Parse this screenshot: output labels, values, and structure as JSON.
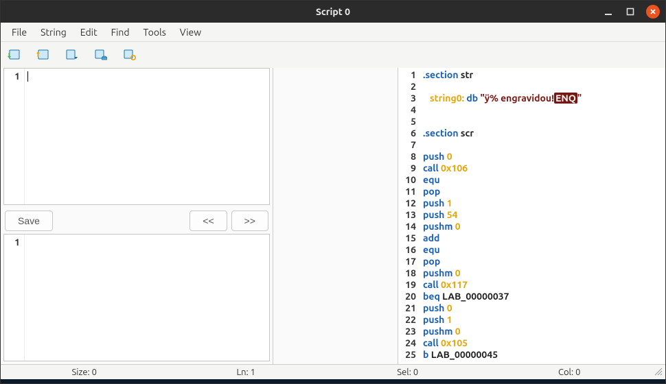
{
  "window": {
    "title": "Script 0"
  },
  "menu": {
    "file": "File",
    "string": "String",
    "edit": "Edit",
    "find": "Find",
    "tools": "Tools",
    "view": "View"
  },
  "left_editor": {
    "line1_no": "1"
  },
  "buttons": {
    "save": "Save",
    "prev": "<<",
    "next": ">>"
  },
  "bottom_editor": {
    "line1_no": "1"
  },
  "asm": {
    "lines": [
      {
        "n": "1",
        "html": "<span class='kw-section'>.section</span> <span class='kw-plain'>str</span>"
      },
      {
        "n": "2",
        "html": ""
      },
      {
        "n": "3",
        "html": "   <span class='kw-lbl'>string0:</span> <span class='kw-op'>db</span> <span class='kw-str'>\"ÿ% engravidou!</span><span class='enq'>ENQ</span><span class='kw-str'>\"</span>"
      },
      {
        "n": "4",
        "html": ""
      },
      {
        "n": "5",
        "html": ""
      },
      {
        "n": "6",
        "html": "<span class='kw-section'>.section</span> <span class='kw-plain'>scr</span>"
      },
      {
        "n": "7",
        "html": ""
      },
      {
        "n": "8",
        "html": "<span class='kw-op'>push</span> <span class='kw-num'>0</span>"
      },
      {
        "n": "9",
        "html": "<span class='kw-op'>call</span> <span class='kw-num'>0x106</span>"
      },
      {
        "n": "10",
        "html": "<span class='kw-op'>equ</span>"
      },
      {
        "n": "11",
        "html": "<span class='kw-op'>pop</span>"
      },
      {
        "n": "12",
        "html": "<span class='kw-op'>push</span> <span class='kw-num'>1</span>"
      },
      {
        "n": "13",
        "html": "<span class='kw-op'>push</span> <span class='kw-num'>54</span>"
      },
      {
        "n": "14",
        "html": "<span class='kw-op'>pushm</span> <span class='kw-num'>0</span>"
      },
      {
        "n": "15",
        "html": "<span class='kw-op'>add</span>"
      },
      {
        "n": "16",
        "html": "<span class='kw-op'>equ</span>"
      },
      {
        "n": "17",
        "html": "<span class='kw-op'>pop</span>"
      },
      {
        "n": "18",
        "html": "<span class='kw-op'>pushm</span> <span class='kw-num'>0</span>"
      },
      {
        "n": "19",
        "html": "<span class='kw-op'>call</span> <span class='kw-num'>0x117</span>"
      },
      {
        "n": "20",
        "html": "<span class='kw-op'>beq</span> <span class='kw-plain'>LAB_00000037</span>"
      },
      {
        "n": "21",
        "html": "<span class='kw-op'>push</span> <span class='kw-num'>0</span>"
      },
      {
        "n": "22",
        "html": "<span class='kw-op'>push</span> <span class='kw-num'>1</span>"
      },
      {
        "n": "23",
        "html": "<span class='kw-op'>pushm</span> <span class='kw-num'>0</span>"
      },
      {
        "n": "24",
        "html": "<span class='kw-op'>call</span> <span class='kw-num'>0x105</span>"
      },
      {
        "n": "25",
        "html": "<span class='kw-op'>b</span> <span class='kw-plain'>LAB_00000045</span>"
      }
    ]
  },
  "status": {
    "size": "Size: 0",
    "ln": "Ln: 1",
    "sel": "Sel: 0",
    "col": "Col: 0"
  }
}
